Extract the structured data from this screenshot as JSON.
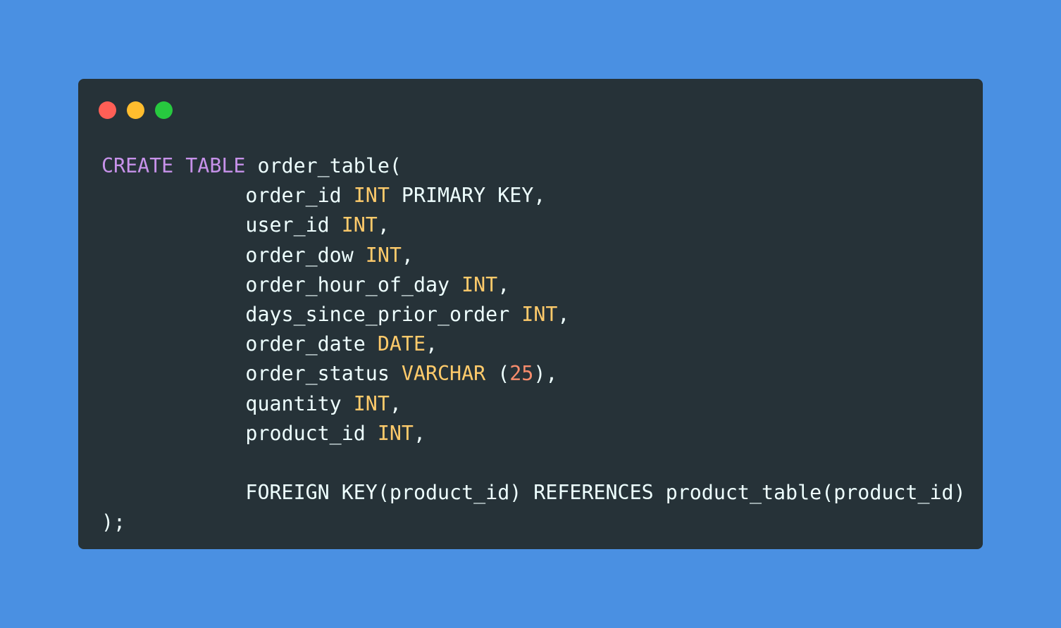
{
  "colors": {
    "background": "#4a90e2",
    "window": "#263238",
    "text": "#eeffff",
    "keyword": "#c792ea",
    "type": "#ffcb6b",
    "number": "#f78c6c"
  },
  "window_controls": [
    {
      "name": "close-dot",
      "color": "#ff5f56"
    },
    {
      "name": "minimize-dot",
      "color": "#ffbd2e"
    },
    {
      "name": "maximize-dot",
      "color": "#27c93f"
    }
  ],
  "code": {
    "language": "sql",
    "lines": [
      [
        {
          "t": "CREATE",
          "c": "keyword"
        },
        {
          "t": " ",
          "c": "text"
        },
        {
          "t": "TABLE",
          "c": "keyword"
        },
        {
          "t": " order_table(",
          "c": "text"
        }
      ],
      [
        {
          "t": "            order_id ",
          "c": "text"
        },
        {
          "t": "INT",
          "c": "type"
        },
        {
          "t": " PRIMARY KEY,",
          "c": "text"
        }
      ],
      [
        {
          "t": "            user_id ",
          "c": "text"
        },
        {
          "t": "INT",
          "c": "type"
        },
        {
          "t": ",",
          "c": "text"
        }
      ],
      [
        {
          "t": "            order_dow ",
          "c": "text"
        },
        {
          "t": "INT",
          "c": "type"
        },
        {
          "t": ",",
          "c": "text"
        }
      ],
      [
        {
          "t": "            order_hour_of_day ",
          "c": "text"
        },
        {
          "t": "INT",
          "c": "type"
        },
        {
          "t": ",",
          "c": "text"
        }
      ],
      [
        {
          "t": "            days_since_prior_order ",
          "c": "text"
        },
        {
          "t": "INT",
          "c": "type"
        },
        {
          "t": ",",
          "c": "text"
        }
      ],
      [
        {
          "t": "            order_date ",
          "c": "text"
        },
        {
          "t": "DATE",
          "c": "type"
        },
        {
          "t": ",",
          "c": "text"
        }
      ],
      [
        {
          "t": "            order_status ",
          "c": "text"
        },
        {
          "t": "VARCHAR",
          "c": "type"
        },
        {
          "t": " (",
          "c": "text"
        },
        {
          "t": "25",
          "c": "number"
        },
        {
          "t": "),",
          "c": "text"
        }
      ],
      [
        {
          "t": "            quantity ",
          "c": "text"
        },
        {
          "t": "INT",
          "c": "type"
        },
        {
          "t": ",",
          "c": "text"
        }
      ],
      [
        {
          "t": "            product_id ",
          "c": "text"
        },
        {
          "t": "INT",
          "c": "type"
        },
        {
          "t": ",",
          "c": "text"
        }
      ],
      [],
      [
        {
          "t": "            FOREIGN KEY(product_id) REFERENCES product_table(product_id)",
          "c": "text"
        }
      ],
      [
        {
          "t": ");",
          "c": "text"
        }
      ]
    ]
  }
}
